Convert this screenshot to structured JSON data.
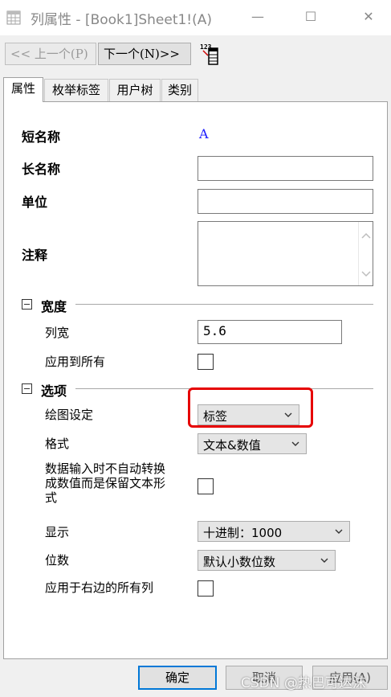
{
  "window": {
    "title": "列属性 - [Book1]Sheet1!(A)",
    "minimize_glyph": "—",
    "maximize_glyph": "☐",
    "close_glyph": "✕"
  },
  "toolbar": {
    "prev_label": "<< 上一个(P)",
    "next_label": "下一个(N)>>",
    "tool_icon": "column-settings-icon",
    "tool_icon_text": "123"
  },
  "tabs": [
    {
      "label": "属性",
      "active": true
    },
    {
      "label": "枚举标签",
      "active": false
    },
    {
      "label": "用户树",
      "active": false
    },
    {
      "label": "类别",
      "active": false
    }
  ],
  "properties": {
    "short_name_label": "短名称",
    "short_name_value": "A",
    "long_name_label": "长名称",
    "long_name_value": "",
    "unit_label": "单位",
    "unit_value": "",
    "comment_label": "注释",
    "comment_value": ""
  },
  "width_section": {
    "title": "宽度",
    "column_width_label": "列宽",
    "column_width_value": "5.6",
    "apply_all_label": "应用到所有",
    "apply_all_checked": false
  },
  "options_section": {
    "title": "选项",
    "plot_designation_label": "绘图设定",
    "plot_designation_value": "标签",
    "format_label": "格式",
    "format_value": "文本&数值",
    "keep_text_label_line1": "数据输入时不自动转换",
    "keep_text_label_line2": "成数值而是保留文本形",
    "keep_text_label_line3": "式",
    "keep_text_checked": false,
    "display_label": "显示",
    "display_value": "十进制：1000",
    "digits_label": "位数",
    "digits_value": "默认小数位数",
    "apply_right_label": "应用于右边的所有列",
    "apply_right_checked": false
  },
  "buttons": {
    "ok": "确定",
    "cancel": "取消",
    "apply": "应用(A)"
  },
  "watermark": "CSDN @热巴可达沫",
  "colors": {
    "highlight": "#e60000",
    "short_name_value": "#1a1aff",
    "ok_border": "#0078d7"
  }
}
